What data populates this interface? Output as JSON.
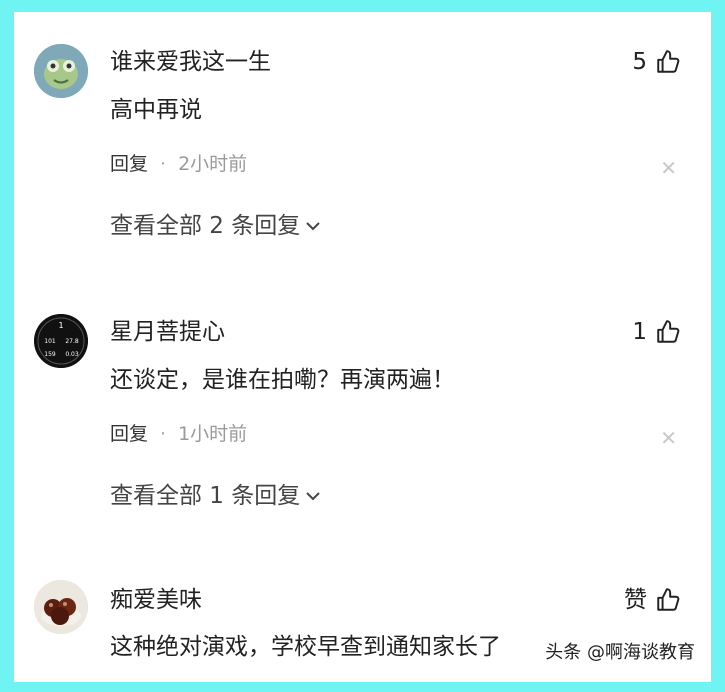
{
  "comments": [
    {
      "username": "谁来爱我这一生",
      "likes": "5",
      "text": "高中再说",
      "reply_label": "回复",
      "separator": "·",
      "time": "2小时前",
      "view_replies": "查看全部 2 条回复"
    },
    {
      "username": "星月菩提心",
      "likes": "1",
      "text": "还谈定，是谁在拍嘞？再演两遍！",
      "reply_label": "回复",
      "separator": "·",
      "time": "1小时前",
      "view_replies": "查看全部 1 条回复"
    },
    {
      "username": "痴爱美味",
      "likes": "赞",
      "text": "这种绝对演戏，学校早查到通知家长了"
    }
  ],
  "watch_face": {
    "top": "1",
    "mid_left": "101",
    "mid_right": "27.8",
    "bottom_left": "159",
    "bottom_right": "0.03"
  },
  "watermark": "头条 @啊海谈教育",
  "colors": {
    "background": "#6ff3f3",
    "panel": "#ffffff",
    "text": "#222222",
    "muted": "#9a9a9a"
  }
}
